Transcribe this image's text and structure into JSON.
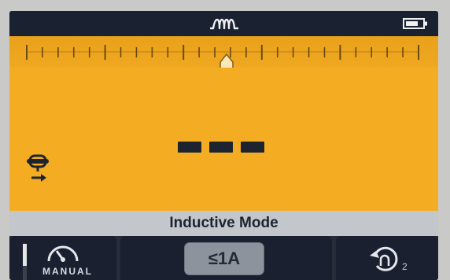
{
  "statusbar": {
    "wave_icon": "inductive-wave-icon",
    "battery_icon": "battery-icon"
  },
  "display": {
    "reading": "---",
    "scale": {
      "ticks": 26,
      "pointer_position": 0.51
    },
    "probe_icon": "probe-direction-icon",
    "background_color": "#f4ad23"
  },
  "mode": {
    "label": "Inductive Mode"
  },
  "softkeys": {
    "auto_manual": {
      "label": "MANUAL",
      "icon": "speedometer-icon"
    },
    "range": {
      "label": "≤1A"
    },
    "rotate": {
      "icon": "rotate-icon",
      "subscript": "2"
    }
  }
}
